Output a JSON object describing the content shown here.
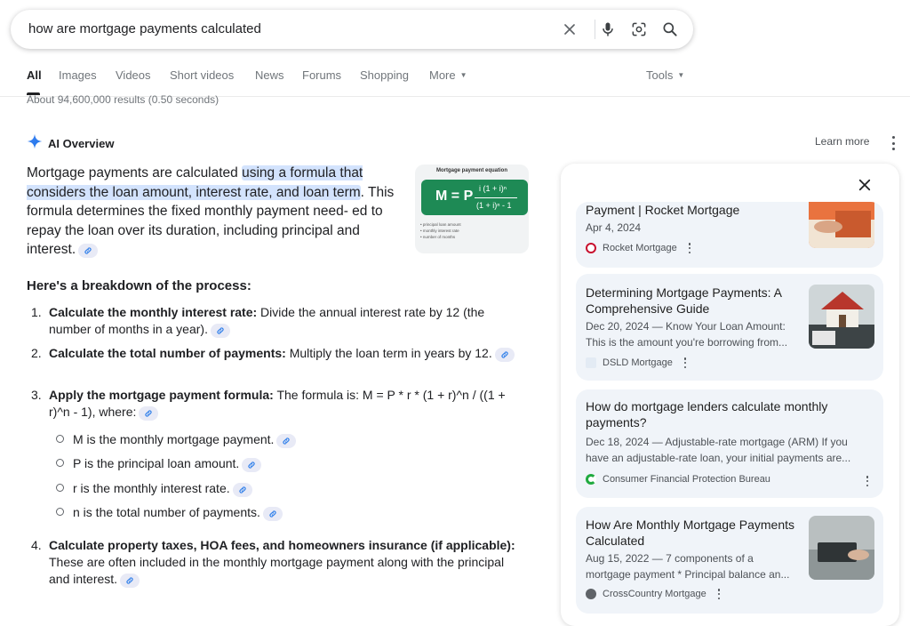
{
  "search": {
    "query": "how are mortgage payments calculated"
  },
  "tabs": [
    {
      "label": "All"
    },
    {
      "label": "Images"
    },
    {
      "label": "Videos"
    },
    {
      "label": "Short videos"
    },
    {
      "label": "News"
    },
    {
      "label": "Forums"
    },
    {
      "label": "Shopping"
    },
    {
      "label": "More"
    }
  ],
  "tools_label": "Tools",
  "results_count": "About 94,600,000 results (0.50 seconds)",
  "ai_overview": {
    "label": "AI Overview",
    "learn_more": "Learn more",
    "intro_pre": "Mortgage payments are calculated ",
    "intro_highlight": "using a formula that considers the loan amount, interest rate, and loan term",
    "intro_post": ". This formula determines the fixed monthly payment need- ed to repay the loan over its duration, including principal and interest.",
    "image": {
      "title": "Mortgage payment equation",
      "lhs": "M = P",
      "numerator": "i (1 + i)ⁿ",
      "denominator": "(1 + i)ⁿ - 1",
      "legend": [
        "• principal loan amount",
        "• monthly interest rate",
        "• number of months"
      ]
    },
    "breakdown_heading": "Here's a breakdown of the process:",
    "steps": [
      {
        "num": "1.",
        "bold": "Calculate the monthly interest rate:",
        "text": " Divide the annual interest rate by 12 (the number of months in a year)."
      },
      {
        "num": "2.",
        "bold": "Calculate the total number of payments:",
        "text": " Multiply the loan term in years by 12."
      },
      {
        "num": "3.",
        "bold": "Apply the mortgage payment formula:",
        "text": " The formula is: M = P * r * (1 + r)^n / ((1 + r)^n - 1), where:"
      },
      {
        "num": "4.",
        "bold": "Calculate property taxes, HOA fees, and homeowners insurance (if applicable):",
        "text": " These are often included in the monthly mortgage payment along with the principal and interest."
      }
    ],
    "sub_items": [
      "M is the monthly mortgage payment.",
      "P is the principal loan amount.",
      "r is the monthly interest rate.",
      "n is the total number of payments."
    ]
  },
  "sources": [
    {
      "title": "Payment | Rocket Mortgage",
      "date": "Apr 4, 2024",
      "source": "Rocket Mortgage",
      "favicon_color": "#c8102e"
    },
    {
      "title": "Determining Mortgage Payments: A Comprehensive Guide",
      "snippet": "Dec 20, 2024 — Know Your Loan Amount: This is the amount you're borrowing from...",
      "source": "DSLD Mortgage",
      "favicon_color": "#6b8fb3"
    },
    {
      "title": "How do mortgage lenders calculate monthly payments?",
      "snippet": "Dec 18, 2024 — Adjustable-rate mortgage (ARM) If you have an adjustable-rate loan, your initial payments are...",
      "source": "Consumer Financial Protection Bureau",
      "favicon_color": "#20aa3f"
    },
    {
      "title": "How Are Monthly Mortgage Payments Calculated",
      "snippet": "Aug 15, 2022 — 7 components of a mortgage payment * Principal balance an...",
      "source": "CrossCountry Mortgage",
      "favicon_color": "#5f6368"
    }
  ],
  "colors": {
    "highlight": "#d3e3fd",
    "card_bg": "#f0f4f9",
    "formula_green": "#1e8a55"
  }
}
